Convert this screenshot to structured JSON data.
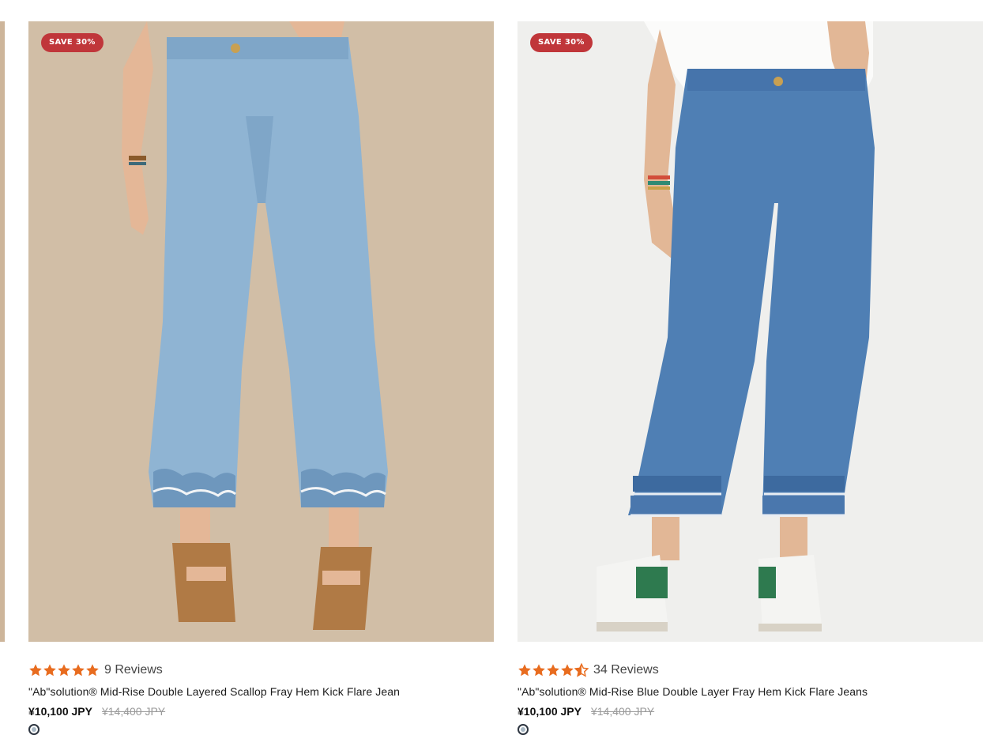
{
  "products": [
    {
      "badge": "SAVE 30%",
      "image_alt": "Light blue cropped kick flare jeans with layered scalloped fray hem",
      "rating": 5,
      "reviews": "9 Reviews",
      "title": "\"Ab\"solution® Mid-Rise Double Layered Scallop Fray Hem Kick Flare Jean",
      "price": "¥10,100 JPY",
      "compare_price": "¥14,400 JPY",
      "swatch_color": "#a8b8c4"
    },
    {
      "badge": "SAVE 30%",
      "image_alt": "Medium blue cropped kick flare jeans with double layer fray hem",
      "rating": 4.5,
      "reviews": "34 Reviews",
      "title": "\"Ab\"solution® Mid-Rise Blue Double Layer Fray Hem Kick Flare Jeans",
      "price": "¥10,100 JPY",
      "compare_price": "¥14,400 JPY",
      "swatch_color": "#a8b8c4"
    }
  ],
  "colors": {
    "badge": "#c0363a",
    "star": "#e86c1f",
    "card1_bg": "#d0bca4",
    "card2_bg": "#efefed",
    "denim_light": "#8db3d2",
    "denim_mid": "#4f7fb4"
  }
}
